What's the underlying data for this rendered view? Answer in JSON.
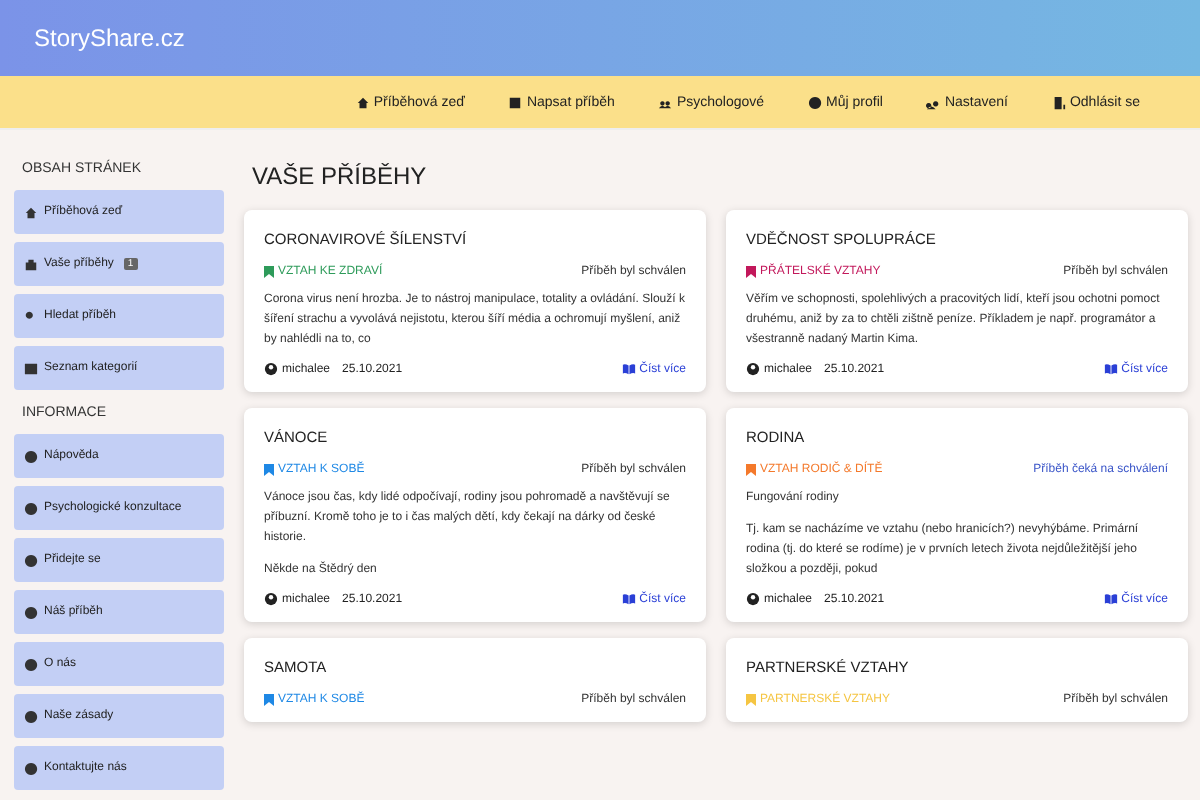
{
  "brand": "StoryShare.cz",
  "nav": [
    {
      "label": "Příběhová zeď"
    },
    {
      "label": "Napsat příběh"
    },
    {
      "label": "Psychologové"
    },
    {
      "label": "Můj profil"
    },
    {
      "label": "Nastavení"
    },
    {
      "label": "Odhlásit se"
    }
  ],
  "sidebar": [
    {
      "heading": "OBSAH STRÁNEK",
      "items": [
        {
          "label": "Příběhová zeď"
        },
        {
          "label": "Vaše příběhy",
          "badge": "1"
        },
        {
          "label": "Hledat příběh"
        },
        {
          "label": "Seznam kategorií"
        }
      ]
    },
    {
      "heading": "INFORMACE",
      "items": [
        {
          "label": "Nápověda"
        },
        {
          "label": "Psychologické konzultace"
        },
        {
          "label": "Přidejte se"
        },
        {
          "label": "Náš příběh"
        },
        {
          "label": "O nás"
        },
        {
          "label": "Naše zásady"
        },
        {
          "label": "Kontaktujte nás"
        }
      ]
    }
  ],
  "page_title": "VAŠE PŘÍBĚHY",
  "stories": [
    {
      "title": "CORONAVIROVÉ ŠÍLENSTVÍ",
      "category": "VZTAH KE ZDRAVÍ",
      "color": "#2e9b5a",
      "status": "Příběh byl schválen",
      "approved": true,
      "paragraphs": [
        "Corona virus není hrozba. Je to nástroj manipulace, totality a ovládání. Slouží k šíření strachu a vyvolává nejistotu, kterou šíří média a ochromují myšlení, aniž by nahlédli na to, co"
      ],
      "author": "michalee",
      "date": "25.10.2021",
      "more": "Číst více"
    },
    {
      "title": "VDĚČNOST SPOLUPRÁCE",
      "category": "PŘÁTELSKÉ VZTAHY",
      "color": "#c2185b",
      "status": "Příběh byl schválen",
      "approved": true,
      "paragraphs": [
        "Věřím ve schopnosti, spolehlivých a pracovitých lidí, kteří jsou ochotni pomoct druhému, aniž by za to chtěli zištně peníze. Příkladem je např. programátor a všestranně nadaný Martin Kima."
      ],
      "author": "michalee",
      "date": "25.10.2021",
      "more": "Číst více"
    },
    {
      "title": "VÁNOCE",
      "category": "VZTAH K SOBĚ",
      "color": "#1e88e5",
      "status": "Příběh byl schválen",
      "approved": true,
      "paragraphs": [
        "Vánoce jsou čas, kdy lidé odpočívají, rodiny jsou pohromadě a navštěvují se příbuzní. Kromě toho je to i čas malých dětí, kdy čekají na dárky od české historie.",
        "Někde na Štědrý den"
      ],
      "author": "michalee",
      "date": "25.10.2021",
      "more": "Číst více"
    },
    {
      "title": "RODINA",
      "category": "VZTAH RODIČ & DÍTĚ",
      "color": "#f4792b",
      "status": "Příběh čeká na schválení",
      "approved": false,
      "paragraphs": [
        "Fungování rodiny",
        "Tj. kam se nacházíme ve vztahu (nebo hranicích?) nevyhýbáme. Primární rodina (tj. do které se rodíme) je v prvních letech života nejdůležitější jeho složkou a později, pokud"
      ],
      "author": "michalee",
      "date": "25.10.2021",
      "more": "Číst více"
    },
    {
      "title": "SAMOTA",
      "category": "VZTAH K SOBĚ",
      "color": "#1e88e5",
      "status": "Příběh byl schválen",
      "approved": true
    },
    {
      "title": "PARTNERSKÉ VZTAHY",
      "category": "PARTNERSKÉ VZTAHY",
      "color": "#f5c542",
      "status": "Příběh byl schválen",
      "approved": true
    }
  ]
}
